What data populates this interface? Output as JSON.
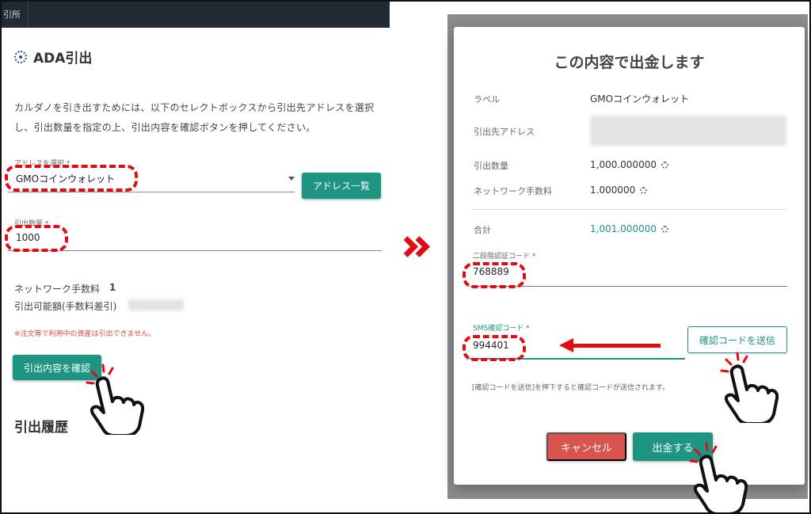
{
  "left": {
    "topbar_tab": "引所",
    "title": "ADA引出",
    "description": "カルダノを引き出すためには、以下のセレクトボックスから引出先アドレスを選択し、引出数量を指定の上、引出内容を確認ボタンを押してください。",
    "address_label": "アドレスを選択 *",
    "address_value": "GMOコインウォレット",
    "address_list_button": "アドレス一覧",
    "amount_label": "引出数量 *",
    "amount_value": "1000",
    "network_fee_label": "ネットワーク手数料",
    "network_fee_value": "1",
    "available_label": "引出可能額(手数料差引)",
    "warning": "※注文等で利用中の資産は引出できません。",
    "confirm_button": "引出内容を確認",
    "history_title": "引出履歴"
  },
  "modal": {
    "title": "この内容で出金します",
    "label_label": "ラベル",
    "label_value": "GMOコインウォレット",
    "address_label": "引出先アドレス",
    "amount_label": "引出数量",
    "amount_value": "1,000.000000",
    "fee_label": "ネットワーク手数料",
    "fee_value": "1.000000",
    "total_label": "合計",
    "total_value": "1,001.000000",
    "twofa_label": "二段階認証コード *",
    "twofa_value": "768889",
    "sms_label": "SMS確認コード *",
    "sms_value": "994401",
    "send_code_button": "確認コードを送信",
    "hint": "[確認コードを送信]を押下すると確認コードが送信されます。",
    "cancel_button": "キャンセル",
    "submit_button": "出金する"
  },
  "colors": {
    "accent": "#1e9483",
    "annotation": "#e20b13",
    "cancel": "#d9534f",
    "topbar": "#202a33"
  },
  "icons": [
    "ada-icon",
    "gear-icon",
    "pointing-hand-icon",
    "double-chevron-right-icon",
    "left-arrow-icon"
  ]
}
